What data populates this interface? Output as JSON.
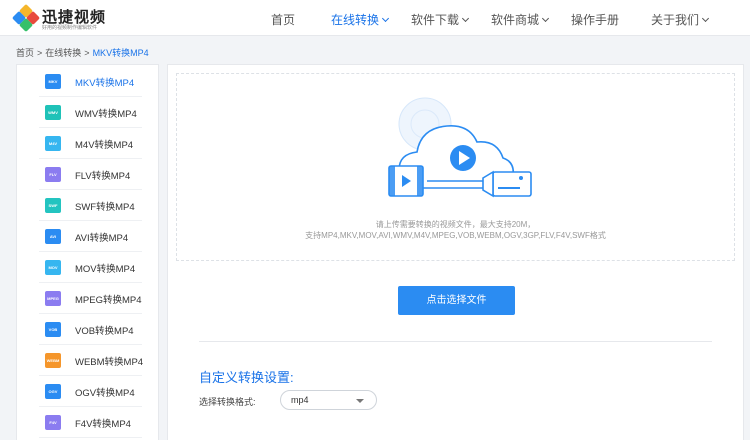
{
  "header": {
    "logo_name": "迅捷视频",
    "logo_sub": "好用的视频制作编辑软件",
    "nav": [
      {
        "label": "首页",
        "dropdown": false
      },
      {
        "label": "在线转换",
        "dropdown": true,
        "active": true
      },
      {
        "label": "软件下载",
        "dropdown": true
      },
      {
        "label": "软件商城",
        "dropdown": true
      },
      {
        "label": "操作手册",
        "dropdown": false
      },
      {
        "label": "关于我们",
        "dropdown": true
      }
    ]
  },
  "breadcrumb": {
    "items": [
      "首页",
      "在线转换",
      "MKV转换MP4"
    ],
    "separator": ">"
  },
  "sidebar": {
    "items": [
      {
        "label": "MKV转换MP4",
        "icon_text": "MKV",
        "icon_color": "#2b8cf2",
        "active": true
      },
      {
        "label": "WMV转换MP4",
        "icon_text": "WMV",
        "icon_color": "#1fc2b8"
      },
      {
        "label": "M4V转换MP4",
        "icon_text": "M4V",
        "icon_color": "#36b6f0"
      },
      {
        "label": "FLV转换MP4",
        "icon_text": "FLV",
        "icon_color": "#8b7cf0"
      },
      {
        "label": "SWF转换MP4",
        "icon_text": "SWF",
        "icon_color": "#23c4c0"
      },
      {
        "label": "AVI转换MP4",
        "icon_text": "AVI",
        "icon_color": "#2b8cf2"
      },
      {
        "label": "MOV转换MP4",
        "icon_text": "MOV",
        "icon_color": "#36b6f0"
      },
      {
        "label": "MPEG转换MP4",
        "icon_text": "MPEG",
        "icon_color": "#8b7cf0"
      },
      {
        "label": "VOB转换MP4",
        "icon_text": "VOB",
        "icon_color": "#2b8cf2"
      },
      {
        "label": "WEBM转换MP4",
        "icon_text": "WEBM",
        "icon_color": "#f5962b"
      },
      {
        "label": "OGV转换MP4",
        "icon_text": "OGV",
        "icon_color": "#2b8cf2"
      },
      {
        "label": "F4V转换MP4",
        "icon_text": "F4V",
        "icon_color": "#8b7cf0"
      }
    ]
  },
  "main": {
    "upload_hint_line1": "请上传需要转换的视频文件，最大支持20M，",
    "upload_hint_line2": "支持MP4,MKV,MOV,AVI,WMV,M4V,MPEG,VOB,WEBM,OGV,3GP,FLV,F4V,SWF格式",
    "select_button": "点击选择文件",
    "settings_title": "自定义转换设置:",
    "format_label": "选择转换格式:",
    "format_value": "mp4"
  },
  "colors": {
    "accent": "#1a73e8",
    "button": "#2b8cf2"
  }
}
